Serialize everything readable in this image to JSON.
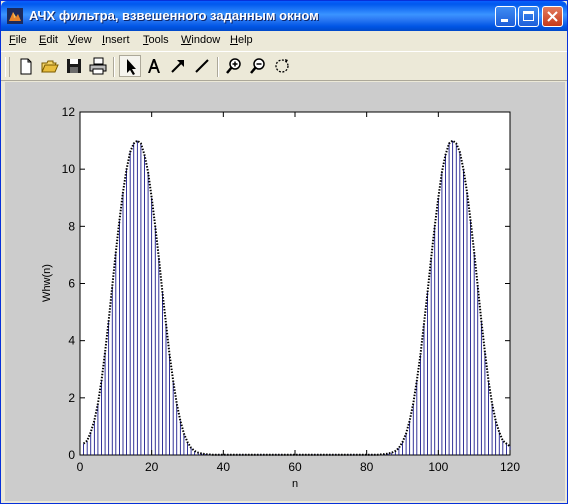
{
  "window": {
    "title": "АЧХ фильтра, взвешенного заданным окном",
    "icon": "matlab-figure-icon"
  },
  "menu": [
    {
      "first": "F",
      "rest": "ile"
    },
    {
      "first": "E",
      "rest": "dit"
    },
    {
      "first": "V",
      "rest": "iew"
    },
    {
      "first": "I",
      "rest": "nsert"
    },
    {
      "first": "T",
      "rest": "ools"
    },
    {
      "first": "W",
      "rest": "indow"
    },
    {
      "first": "H",
      "rest": "elp"
    }
  ],
  "toolbar": [
    "new-figure-icon",
    "open-file-icon",
    "save-icon",
    "print-icon",
    "arrow-select-icon",
    "insert-text-icon",
    "insert-arrow-icon",
    "insert-line-icon",
    "zoom-in-icon",
    "zoom-out-icon",
    "rotate-3d-icon"
  ],
  "chart_data": {
    "type": "stem",
    "title": "",
    "xlabel": "n",
    "ylabel": "Whw(n)",
    "xlim": [
      0,
      120
    ],
    "ylim": [
      0,
      12
    ],
    "xticks": [
      0,
      20,
      40,
      60,
      80,
      100,
      120
    ],
    "yticks": [
      0,
      2,
      4,
      6,
      8,
      10,
      12
    ],
    "stem_color": "#00007F",
    "envelope_color": "#000000",
    "envelope_style": "dotted",
    "series": [
      {
        "x": [
          1,
          2,
          3,
          4,
          5,
          6,
          7,
          8,
          9,
          10,
          11,
          12,
          13,
          14,
          15,
          16,
          17,
          18,
          19,
          20,
          21,
          22,
          23,
          24,
          25,
          26,
          27,
          28,
          29,
          30,
          31,
          32,
          33,
          34,
          35,
          36,
          37,
          38,
          39,
          40,
          41,
          42,
          43,
          44,
          45,
          46,
          47,
          48,
          49,
          50,
          51,
          52,
          53,
          54,
          55,
          56,
          57,
          58,
          59,
          60,
          61,
          62,
          63,
          64,
          65,
          66,
          67,
          68,
          69,
          70,
          71,
          72,
          73,
          74,
          75,
          76,
          77,
          78,
          79,
          80,
          81,
          82,
          83,
          84,
          85,
          86,
          87,
          88,
          89,
          90,
          91,
          92,
          93,
          94,
          95,
          96,
          97,
          98,
          99,
          100,
          101,
          102,
          103,
          104,
          105,
          106,
          107,
          108,
          109,
          110,
          111,
          112,
          113,
          114,
          115,
          116,
          117,
          118,
          119,
          120
        ],
        "values": [
          0.4,
          0.5,
          0.8,
          1.2,
          1.8,
          2.6,
          3.6,
          4.7,
          5.9,
          7.1,
          8.2,
          9.2,
          10.0,
          10.6,
          10.9,
          11.0,
          10.9,
          10.5,
          9.9,
          9.0,
          8.0,
          6.9,
          5.7,
          4.6,
          3.5,
          2.6,
          1.8,
          1.2,
          0.75,
          0.45,
          0.25,
          0.14,
          0.08,
          0.05,
          0.03,
          0.02,
          0.01,
          0.01,
          0.01,
          0.01,
          0.01,
          0.01,
          0.01,
          0.01,
          0.01,
          0.01,
          0.01,
          0.01,
          0.01,
          0.01,
          0.01,
          0.01,
          0.01,
          0.01,
          0.01,
          0.01,
          0.01,
          0.01,
          0.01,
          0.01,
          0.01,
          0.01,
          0.01,
          0.01,
          0.01,
          0.01,
          0.01,
          0.01,
          0.01,
          0.01,
          0.01,
          0.01,
          0.01,
          0.01,
          0.01,
          0.01,
          0.01,
          0.01,
          0.01,
          0.01,
          0.01,
          0.01,
          0.01,
          0.02,
          0.03,
          0.05,
          0.08,
          0.14,
          0.25,
          0.45,
          0.75,
          1.2,
          1.8,
          2.6,
          3.5,
          4.6,
          5.7,
          6.9,
          8.0,
          9.0,
          9.9,
          10.5,
          10.9,
          11.0,
          10.9,
          10.6,
          10.0,
          9.2,
          8.2,
          7.1,
          5.9,
          4.7,
          3.6,
          2.6,
          1.8,
          1.2,
          0.8,
          0.5,
          0.4,
          0.3
        ]
      }
    ]
  }
}
